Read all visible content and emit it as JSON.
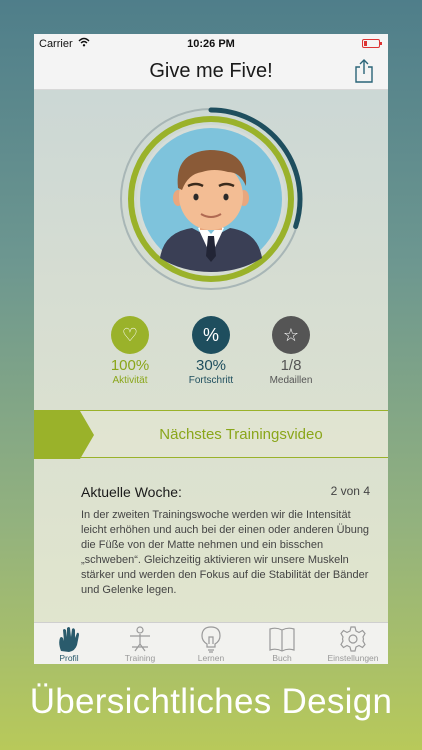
{
  "status": {
    "carrier": "Carrier",
    "time": "10:26 PM"
  },
  "nav": {
    "title": "Give me Five!"
  },
  "stats": [
    {
      "icon": "♡",
      "value": "100%",
      "label": "Aktivität",
      "color": "#8aa61a",
      "circle": "#9ab22a"
    },
    {
      "icon": "%",
      "value": "30%",
      "label": "Fortschritt",
      "color": "#1e4e5e",
      "circle": "#1e4e5e"
    },
    {
      "icon": "☆",
      "value": "1/8",
      "label": "Medaillen",
      "color": "#555555",
      "circle": "#555555"
    }
  ],
  "banner": {
    "label": "Nächstes Trainingsvideo"
  },
  "week": {
    "title": "Aktuelle Woche:",
    "count": "2 von 4",
    "text": "In der zweiten Trainingswoche werden wir die Intensität leicht erhöhen und auch bei der einen oder anderen Übung die Füße von der Matte nehmen und ein bisschen „schweben“. Gleichzeitig aktivieren wir unsere Muskeln stärker und werden den Fokus auf die Stabilität der Bänder und Gelenke legen."
  },
  "tabs": [
    {
      "label": "Profil",
      "icon": "hand-icon",
      "active": true
    },
    {
      "label": "Training",
      "icon": "person-icon",
      "active": false
    },
    {
      "label": "Lernen",
      "icon": "lightbulb-icon",
      "active": false
    },
    {
      "label": "Buch",
      "icon": "book-icon",
      "active": false
    },
    {
      "label": "Einstellungen",
      "icon": "gear-icon",
      "active": false
    }
  ],
  "caption": "Übersichtliches Design",
  "progress": {
    "inner_ring": 1.0,
    "outer_ring": 0.3
  }
}
